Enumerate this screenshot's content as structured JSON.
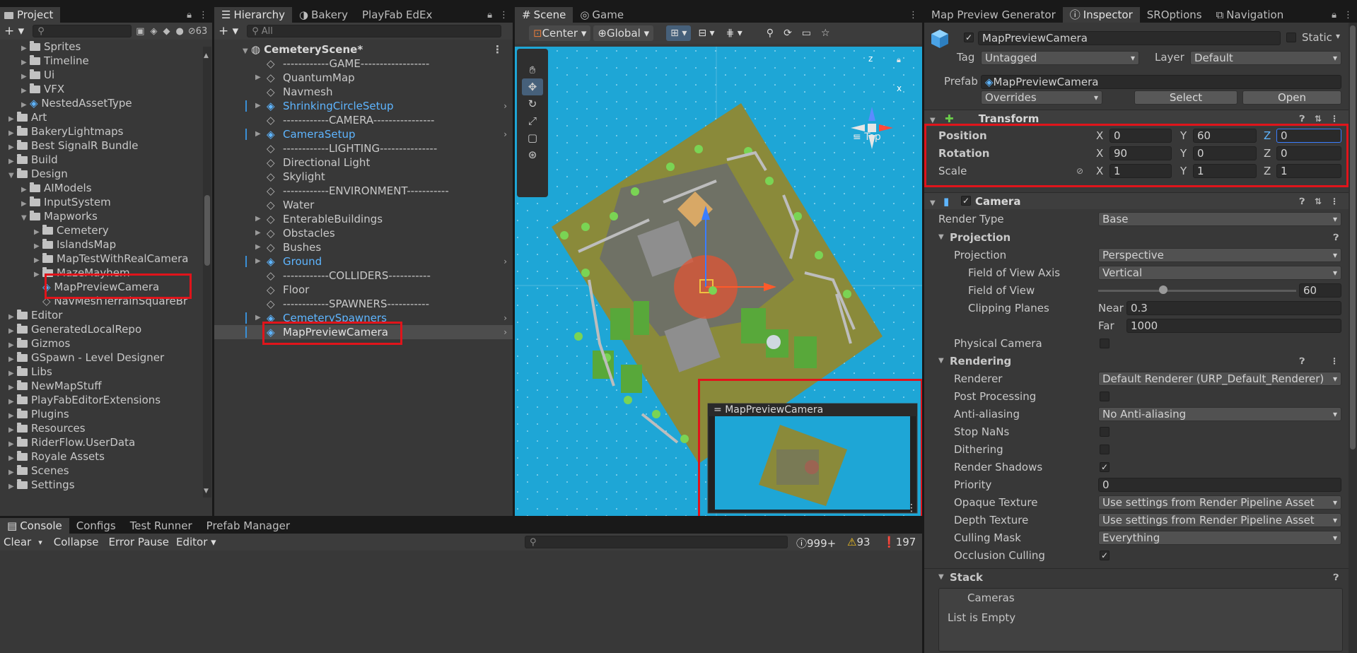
{
  "project": {
    "tab": "Project",
    "hidden_count": "63",
    "items": [
      {
        "label": "Sprites",
        "indent": 2,
        "type": "folder",
        "expanded": false
      },
      {
        "label": "Timeline",
        "indent": 2,
        "type": "folder",
        "expanded": false
      },
      {
        "label": "Ui",
        "indent": 2,
        "type": "folder",
        "expanded": false
      },
      {
        "label": "VFX",
        "indent": 2,
        "type": "folder",
        "expanded": false
      },
      {
        "label": "NestedAssetType",
        "indent": 2,
        "type": "prefab",
        "expanded": false
      },
      {
        "label": "Art",
        "indent": 1,
        "type": "folder",
        "expanded": false
      },
      {
        "label": "BakeryLightmaps",
        "indent": 1,
        "type": "folder",
        "expanded": false
      },
      {
        "label": "Best SignalR Bundle",
        "indent": 1,
        "type": "folder",
        "expanded": false
      },
      {
        "label": "Build",
        "indent": 1,
        "type": "folder",
        "expanded": false
      },
      {
        "label": "Design",
        "indent": 1,
        "type": "folder",
        "expanded": true
      },
      {
        "label": "AIModels",
        "indent": 2,
        "type": "folder",
        "expanded": false
      },
      {
        "label": "InputSystem",
        "indent": 2,
        "type": "folder",
        "expanded": false
      },
      {
        "label": "Mapworks",
        "indent": 2,
        "type": "folder",
        "expanded": true
      },
      {
        "label": "Cemetery",
        "indent": 3,
        "type": "folder",
        "expanded": false
      },
      {
        "label": "IslandsMap",
        "indent": 3,
        "type": "folder",
        "expanded": false
      },
      {
        "label": "MapTestWithRealCamera",
        "indent": 3,
        "type": "folder",
        "expanded": false
      },
      {
        "label": "MazeMayhem",
        "indent": 3,
        "type": "folder",
        "expanded": false
      },
      {
        "label": "MapPreviewCamera",
        "indent": 3,
        "type": "prefab",
        "expanded": false,
        "noarrow": true
      },
      {
        "label": "NavMeshTerrainSquareBr",
        "indent": 3,
        "type": "asset",
        "expanded": false,
        "noarrow": true
      },
      {
        "label": "Editor",
        "indent": 1,
        "type": "folder",
        "expanded": false
      },
      {
        "label": "GeneratedLocalRepo",
        "indent": 1,
        "type": "folder",
        "expanded": false
      },
      {
        "label": "Gizmos",
        "indent": 1,
        "type": "folder",
        "expanded": false
      },
      {
        "label": "GSpawn - Level Designer",
        "indent": 1,
        "type": "folder",
        "expanded": false
      },
      {
        "label": "Libs",
        "indent": 1,
        "type": "folder",
        "expanded": false
      },
      {
        "label": "NewMapStuff",
        "indent": 1,
        "type": "folder",
        "expanded": false
      },
      {
        "label": "PlayFabEditorExtensions",
        "indent": 1,
        "type": "folder",
        "expanded": false
      },
      {
        "label": "Plugins",
        "indent": 1,
        "type": "folder",
        "expanded": false
      },
      {
        "label": "Resources",
        "indent": 1,
        "type": "folder",
        "expanded": false
      },
      {
        "label": "RiderFlow.UserData",
        "indent": 1,
        "type": "folder",
        "expanded": false
      },
      {
        "label": "Royale Assets",
        "indent": 1,
        "type": "folder",
        "expanded": false
      },
      {
        "label": "Scenes",
        "indent": 1,
        "type": "folder",
        "expanded": false
      },
      {
        "label": "Settings",
        "indent": 1,
        "type": "folder",
        "expanded": false
      }
    ]
  },
  "hierarchy": {
    "tabs": [
      "Hierarchy",
      "Bakery",
      "PlayFab EdEx"
    ],
    "search_placeholder": "All",
    "scene": "CemeteryScene*",
    "items": [
      {
        "label": "------------GAME------------------",
        "type": "obj",
        "arrow": false
      },
      {
        "label": "QuantumMap",
        "type": "obj",
        "arrow": true
      },
      {
        "label": "Navmesh",
        "type": "obj",
        "arrow": false
      },
      {
        "label": "ShrinkingCircleSetup",
        "type": "prefab",
        "arrow": true,
        "more": true
      },
      {
        "label": "------------CAMERA----------------",
        "type": "obj",
        "arrow": false
      },
      {
        "label": "CameraSetup",
        "type": "prefab",
        "arrow": true,
        "more": true
      },
      {
        "label": "------------LIGHTING---------------",
        "type": "obj",
        "arrow": false
      },
      {
        "label": "Directional Light",
        "type": "obj",
        "arrow": false
      },
      {
        "label": "Skylight",
        "type": "obj",
        "arrow": false
      },
      {
        "label": "------------ENVIRONMENT-----------",
        "type": "obj",
        "arrow": false
      },
      {
        "label": "Water",
        "type": "obj",
        "arrow": false
      },
      {
        "label": "EnterableBuildings",
        "type": "obj",
        "arrow": true
      },
      {
        "label": "Obstacles",
        "type": "obj",
        "arrow": true
      },
      {
        "label": "Bushes",
        "type": "obj",
        "arrow": true
      },
      {
        "label": "Ground",
        "type": "prefab",
        "arrow": true,
        "more": true
      },
      {
        "label": "------------COLLIDERS-----------",
        "type": "obj",
        "arrow": false
      },
      {
        "label": "Floor",
        "type": "obj",
        "arrow": false
      },
      {
        "label": "------------SPAWNERS-----------",
        "type": "obj",
        "arrow": false
      },
      {
        "label": "CemeterySpawners",
        "type": "prefab",
        "arrow": true,
        "more": true
      },
      {
        "label": "MapPreviewCamera",
        "type": "prefab",
        "arrow": false,
        "more": true,
        "selected": true
      }
    ]
  },
  "scene": {
    "tabs": [
      "Scene",
      "Game"
    ],
    "pivot": "Center",
    "space": "Global",
    "view_label": "Top",
    "axis_x": "x",
    "axis_z": "z",
    "preview_title": "MapPreviewCamera"
  },
  "console": {
    "tabs": [
      "Console",
      "Configs",
      "Test Runner",
      "Prefab Manager"
    ],
    "clear": "Clear",
    "collapse": "Collapse",
    "error_pause": "Error Pause",
    "editor": "Editor",
    "log_count": "999+",
    "warn_count": "93",
    "error_count": "197"
  },
  "inspector": {
    "tabs": [
      "Map Preview Generator",
      "Inspector",
      "SROptions",
      "Navigation"
    ],
    "object_name": "MapPreviewCamera",
    "static_label": "Static",
    "tag_label": "Tag",
    "tag_value": "Untagged",
    "layer_label": "Layer",
    "layer_value": "Default",
    "prefab_label": "Prefab",
    "prefab_value": "MapPreviewCamera",
    "overrides": "Overrides",
    "select": "Select",
    "open": "Open",
    "transform": {
      "title": "Transform",
      "position_label": "Position",
      "rotation_label": "Rotation",
      "scale_label": "Scale",
      "position": {
        "x": "0",
        "y": "60",
        "z": "0"
      },
      "rotation": {
        "x": "90",
        "y": "0",
        "z": "0"
      },
      "scale": {
        "x": "1",
        "y": "1",
        "z": "1"
      }
    },
    "camera": {
      "title": "Camera",
      "render_type_label": "Render Type",
      "render_type": "Base",
      "projection_section": "Projection",
      "projection_label": "Projection",
      "projection": "Perspective",
      "fov_axis_label": "Field of View Axis",
      "fov_axis": "Vertical",
      "fov_label": "Field of View",
      "fov": "60",
      "fov_fraction": 0.33,
      "clipping_label": "Clipping Planes",
      "near_label": "Near",
      "near": "0.3",
      "far_label": "Far",
      "far": "1000",
      "physical_label": "Physical Camera",
      "rendering_section": "Rendering",
      "renderer_label": "Renderer",
      "renderer": "Default Renderer (URP_Default_Renderer)",
      "post_label": "Post Processing",
      "aa_label": "Anti-aliasing",
      "aa": "No Anti-aliasing",
      "stopnans_label": "Stop NaNs",
      "dither_label": "Dithering",
      "shadows_label": "Render Shadows",
      "priority_label": "Priority",
      "priority": "0",
      "opaque_label": "Opaque Texture",
      "opaque": "Use settings from Render Pipeline Asset",
      "depth_label": "Depth Texture",
      "depth": "Use settings from Render Pipeline Asset",
      "culling_label": "Culling Mask",
      "culling": "Everything",
      "occlusion_label": "Occlusion Culling",
      "stack_section": "Stack",
      "cameras_label": "Cameras",
      "list_label": "List is Empty"
    }
  },
  "colors": {
    "highlight": "#e0141b",
    "link": "#5eb5ff",
    "water": "#1ea6d6"
  }
}
